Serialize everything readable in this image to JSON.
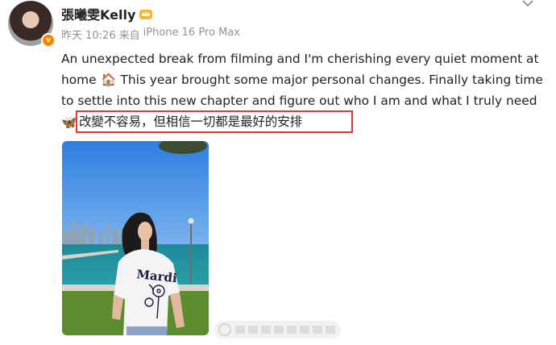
{
  "user": {
    "name": "張曦雯Kelly",
    "badge": "v"
  },
  "post": {
    "time": "昨天 10:26",
    "source_prefix": "来自",
    "source_device": "iPhone 16 Pro Max",
    "text_main": "An unexpected break from filming and I'm cherishing every quiet moment at home ",
    "house_emoji": "🏠",
    "text_mid": " This year brought some major personal changes. Finally taking time to settle into this new chapter and figure out who I am and what I truly need ",
    "butterfly_emoji": "🦋",
    "highlighted_text": "改變不容易，但相信一切都是最好的安排"
  },
  "photo": {
    "shirt_text": "Mardi"
  },
  "icons": {
    "crown": "crown-icon",
    "dropdown": "chevron-down-icon"
  },
  "colors": {
    "highlight_border": "#e53935",
    "meta_text": "#939393",
    "badge": "#ff8200"
  }
}
